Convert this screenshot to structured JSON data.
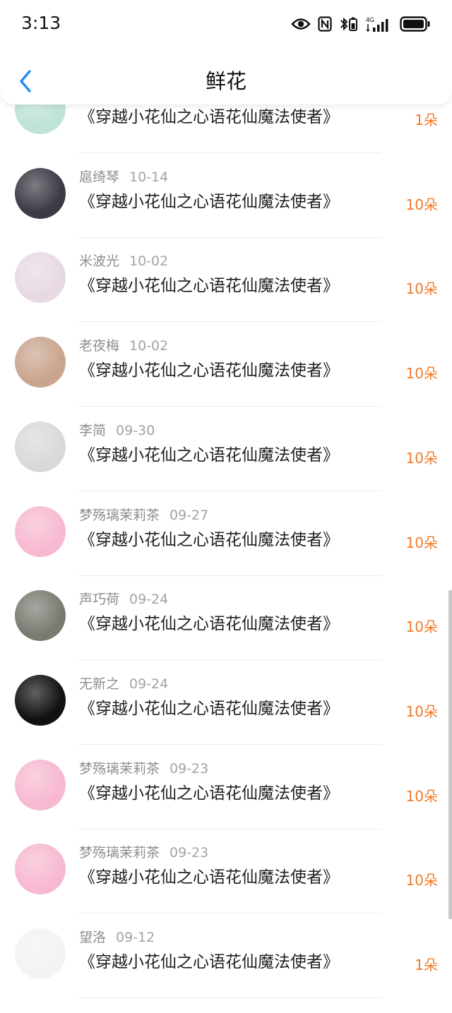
{
  "status": {
    "time": "3:13",
    "network": "4G"
  },
  "header": {
    "title": "鲜花"
  },
  "list": {
    "rows": [
      {
        "name": "",
        "date": "",
        "book": "《穿越小花仙之心语花仙魔法使者》",
        "count": "1朵",
        "avatar_color": "#bfe3d6"
      },
      {
        "name": "扈绮琴",
        "date": "10-14",
        "book": "《穿越小花仙之心语花仙魔法使者》",
        "count": "10朵",
        "avatar_color": "#3c3a44"
      },
      {
        "name": "米波光",
        "date": "10-02",
        "book": "《穿越小花仙之心语花仙魔法使者》",
        "count": "10朵",
        "avatar_color": "#e7d9e4"
      },
      {
        "name": "老夜梅",
        "date": "10-02",
        "book": "《穿越小花仙之心语花仙魔法使者》",
        "count": "10朵",
        "avatar_color": "#c9a58f"
      },
      {
        "name": "李简",
        "date": "09-30",
        "book": "《穿越小花仙之心语花仙魔法使者》",
        "count": "10朵",
        "avatar_color": "#d9d9d9"
      },
      {
        "name": "梦殇璃茉莉茶",
        "date": "09-27",
        "book": "《穿越小花仙之心语花仙魔法使者》",
        "count": "10朵",
        "avatar_color": "#f7b9d1"
      },
      {
        "name": "声巧荷",
        "date": "09-24",
        "book": "《穿越小花仙之心语花仙魔法使者》",
        "count": "10朵",
        "avatar_color": "#7b7a72"
      },
      {
        "name": "无新之",
        "date": "09-24",
        "book": "《穿越小花仙之心语花仙魔法使者》",
        "count": "10朵",
        "avatar_color": "#111111"
      },
      {
        "name": "梦殇璃茉莉茶",
        "date": "09-23",
        "book": "《穿越小花仙之心语花仙魔法使者》",
        "count": "10朵",
        "avatar_color": "#f7b9d1"
      },
      {
        "name": "梦殇璃茉莉茶",
        "date": "09-23",
        "book": "《穿越小花仙之心语花仙魔法使者》",
        "count": "10朵",
        "avatar_color": "#f7b9d1"
      },
      {
        "name": "望洛",
        "date": "09-12",
        "book": "《穿越小花仙之心语花仙魔法使者》",
        "count": "1朵",
        "avatar_color": "#f3f3f3"
      }
    ]
  }
}
